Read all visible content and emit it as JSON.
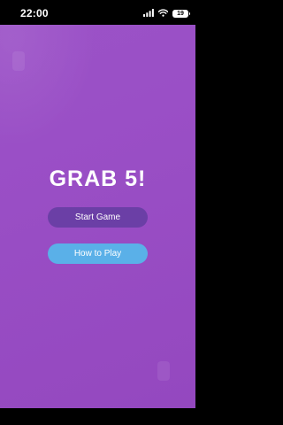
{
  "status_bar": {
    "time": "22:00",
    "battery_level": "19"
  },
  "game": {
    "title": "GRAB 5!",
    "start_button_label": "Start Game",
    "how_to_play_button_label": "How to Play"
  },
  "colors": {
    "background": "#9a4fc6",
    "start_button": "#6b3fa6",
    "how_to_play_button": "#5ab0e8",
    "title_text": "#ffffff"
  },
  "icons": [
    "signal-icon",
    "wifi-icon",
    "battery-icon"
  ]
}
